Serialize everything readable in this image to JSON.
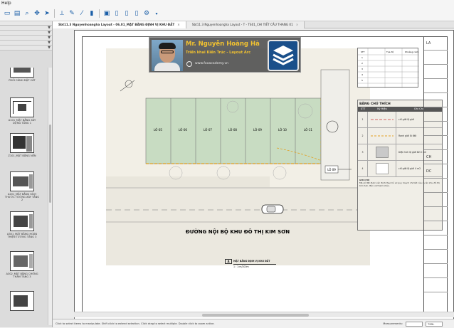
{
  "menubar": {
    "help_label": "Help"
  },
  "toolbar": {
    "icons": [
      "new-file-icon",
      "open-folder-icon",
      "zoom-icon",
      "pan-icon",
      "select-arrow-icon",
      "measure-icon",
      "pen-icon",
      "eyedropper-icon",
      "highlighter-icon",
      "fit-page-icon",
      "page-icon",
      "page-add-icon",
      "page-remove-icon",
      "gear-icon"
    ]
  },
  "tabs": [
    {
      "label": "Sbt11.3 Nguyenhoangha Layout - 06.01_MẶT BẰNG ĐỊNH VỊ KHU ĐẤT",
      "active": true
    },
    {
      "label": "Sbt11.3 Nguyenhoangha Layout - T - TS01_CHI TIẾT CẦU THANG 01",
      "active": false
    }
  ],
  "sidebar": {
    "thumbnails": [
      {
        "caption": "PHỐI CẢNH MẶT CẮT"
      },
      {
        "caption": "A101_MẶT BẰNG XÂY DỰNG TẦNG 1"
      },
      {
        "caption": "Z101_MẶT BẰNG NỀN"
      },
      {
        "caption": "A201_MẶT BẰNG KÍCH THƯỚC TƯỜNG XÂY TẦNG 2"
      },
      {
        "caption": "A301_MẶT BẰNG HOÀN THIỆN TƯỜNG TẦNG 3"
      },
      {
        "caption": "A302_MẶT BẰNG CHỐNG THẤM TẦNG 3"
      },
      {
        "caption": ""
      }
    ]
  },
  "drawing": {
    "road_label": "ĐƯỜNG NỘI BỘ KHU ĐÔ THỊ KIM SƠN",
    "lot_labels": [
      "LÔ-05",
      "LÔ-06",
      "LÔ-07",
      "LÔ-08",
      "LÔ-09",
      "LÔ-10",
      "LÔ-11"
    ],
    "dim_label": "LÔ 09"
  },
  "view_title": {
    "number": "A",
    "name": "MẶT BẰNG ĐỊNH VỊ KHU ĐẤT",
    "scale": "1 : 1:m/200m"
  },
  "legend": {
    "title": "BẢNG CHÚ THÍCH",
    "headers": [
      "STT",
      "Ký Hiệu",
      "Ghi Chú"
    ],
    "rows": [
      {
        "stt": "1",
        "note": "chỉ giới lộ giới"
      },
      {
        "stt": "2",
        "note": "Ranh giới lô đất"
      },
      {
        "stt": "3",
        "note": "Diện tích lộ giới 82.5 m2"
      },
      {
        "stt": "4",
        "note": "chỉ giới lộ giới 4 m2"
      }
    ],
    "notes_title": "GHI CHÚ",
    "notes": "Mã số đất được xác định theo hồ sơ quy hoạch chi tiết của dự án khu đô thị Kim Sơn. Bản vẽ tham khảo."
  },
  "small_table": {
    "headers": [
      "STT",
      "Tọa độ",
      "",
      "Khoảng cách"
    ],
    "rows": [
      [
        "1",
        "",
        "",
        ""
      ],
      [
        "2",
        "",
        "",
        ""
      ],
      [
        "3",
        "",
        "",
        ""
      ],
      [
        "4",
        "",
        "",
        ""
      ],
      [
        "5",
        "",
        "",
        ""
      ]
    ]
  },
  "badge": {
    "name": "Mr. Nguyễn Hoàng Hà",
    "role": "Triển khai Kiến Trúc - Layout Arc",
    "site": "www.fooacademy.vn"
  },
  "title_block": {
    "items": [
      "LA",
      "",
      "",
      "",
      "",
      "",
      "",
      "",
      "CH",
      "DC",
      "",
      "",
      "",
      "",
      "",
      "",
      "",
      "",
      ""
    ]
  },
  "status": {
    "hint": "Click to select items to manipulate. Shift click to extend selection. Click drag to select multiple. Double click to zoom active.",
    "measurements_label": "Measurements:",
    "units_value": "TSDL"
  }
}
